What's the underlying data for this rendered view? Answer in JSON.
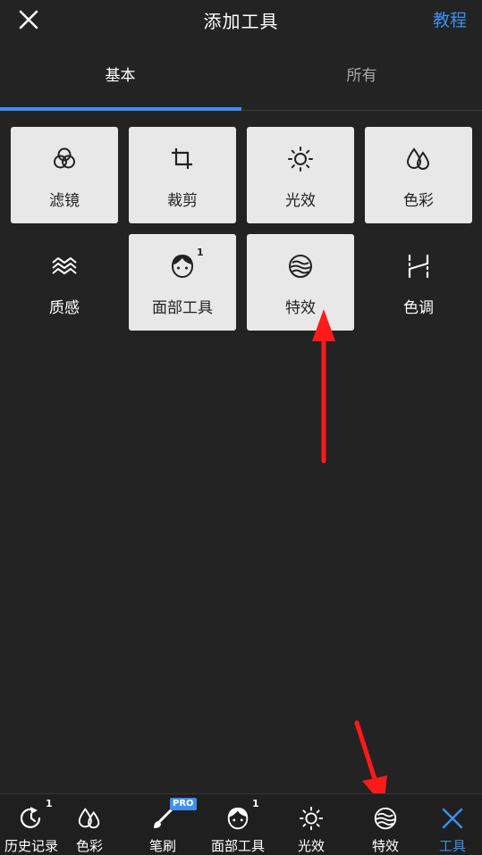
{
  "header": {
    "title": "添加工具",
    "tutorial_label": "教程",
    "close_icon": "close-icon"
  },
  "tabs": [
    {
      "label": "基本",
      "active": true
    },
    {
      "label": "所有",
      "active": false
    }
  ],
  "tools": [
    {
      "label": "滤镜",
      "icon": "filter-icon",
      "added": true
    },
    {
      "label": "裁剪",
      "icon": "crop-icon",
      "added": true
    },
    {
      "label": "光效",
      "icon": "light-icon",
      "added": true
    },
    {
      "label": "色彩",
      "icon": "color-drops-icon",
      "added": true
    },
    {
      "label": "质感",
      "icon": "texture-icon",
      "added": false
    },
    {
      "label": "面部工具",
      "icon": "face-icon",
      "added": true,
      "badge": "1"
    },
    {
      "label": "特效",
      "icon": "effects-icon",
      "added": true
    },
    {
      "label": "色调",
      "icon": "tone-icon",
      "added": false
    }
  ],
  "bottom_bar": [
    {
      "label": "历史记录",
      "icon": "history-icon",
      "badge": "1"
    },
    {
      "label": "色彩",
      "icon": "color-drops-icon"
    },
    {
      "label": "笔刷",
      "icon": "brush-icon",
      "pro_badge": "PRO"
    },
    {
      "label": "面部工具",
      "icon": "face-icon",
      "badge": "1"
    },
    {
      "label": "光效",
      "icon": "light-icon"
    },
    {
      "label": "特效",
      "icon": "effects-icon"
    },
    {
      "label": "工具",
      "icon": "tools-close-icon",
      "active": true
    }
  ],
  "colors": {
    "background": "#232323",
    "accent": "#3d8ff0",
    "tile": "#e8e8e8",
    "annotation_arrow": "#ff1a1a"
  }
}
